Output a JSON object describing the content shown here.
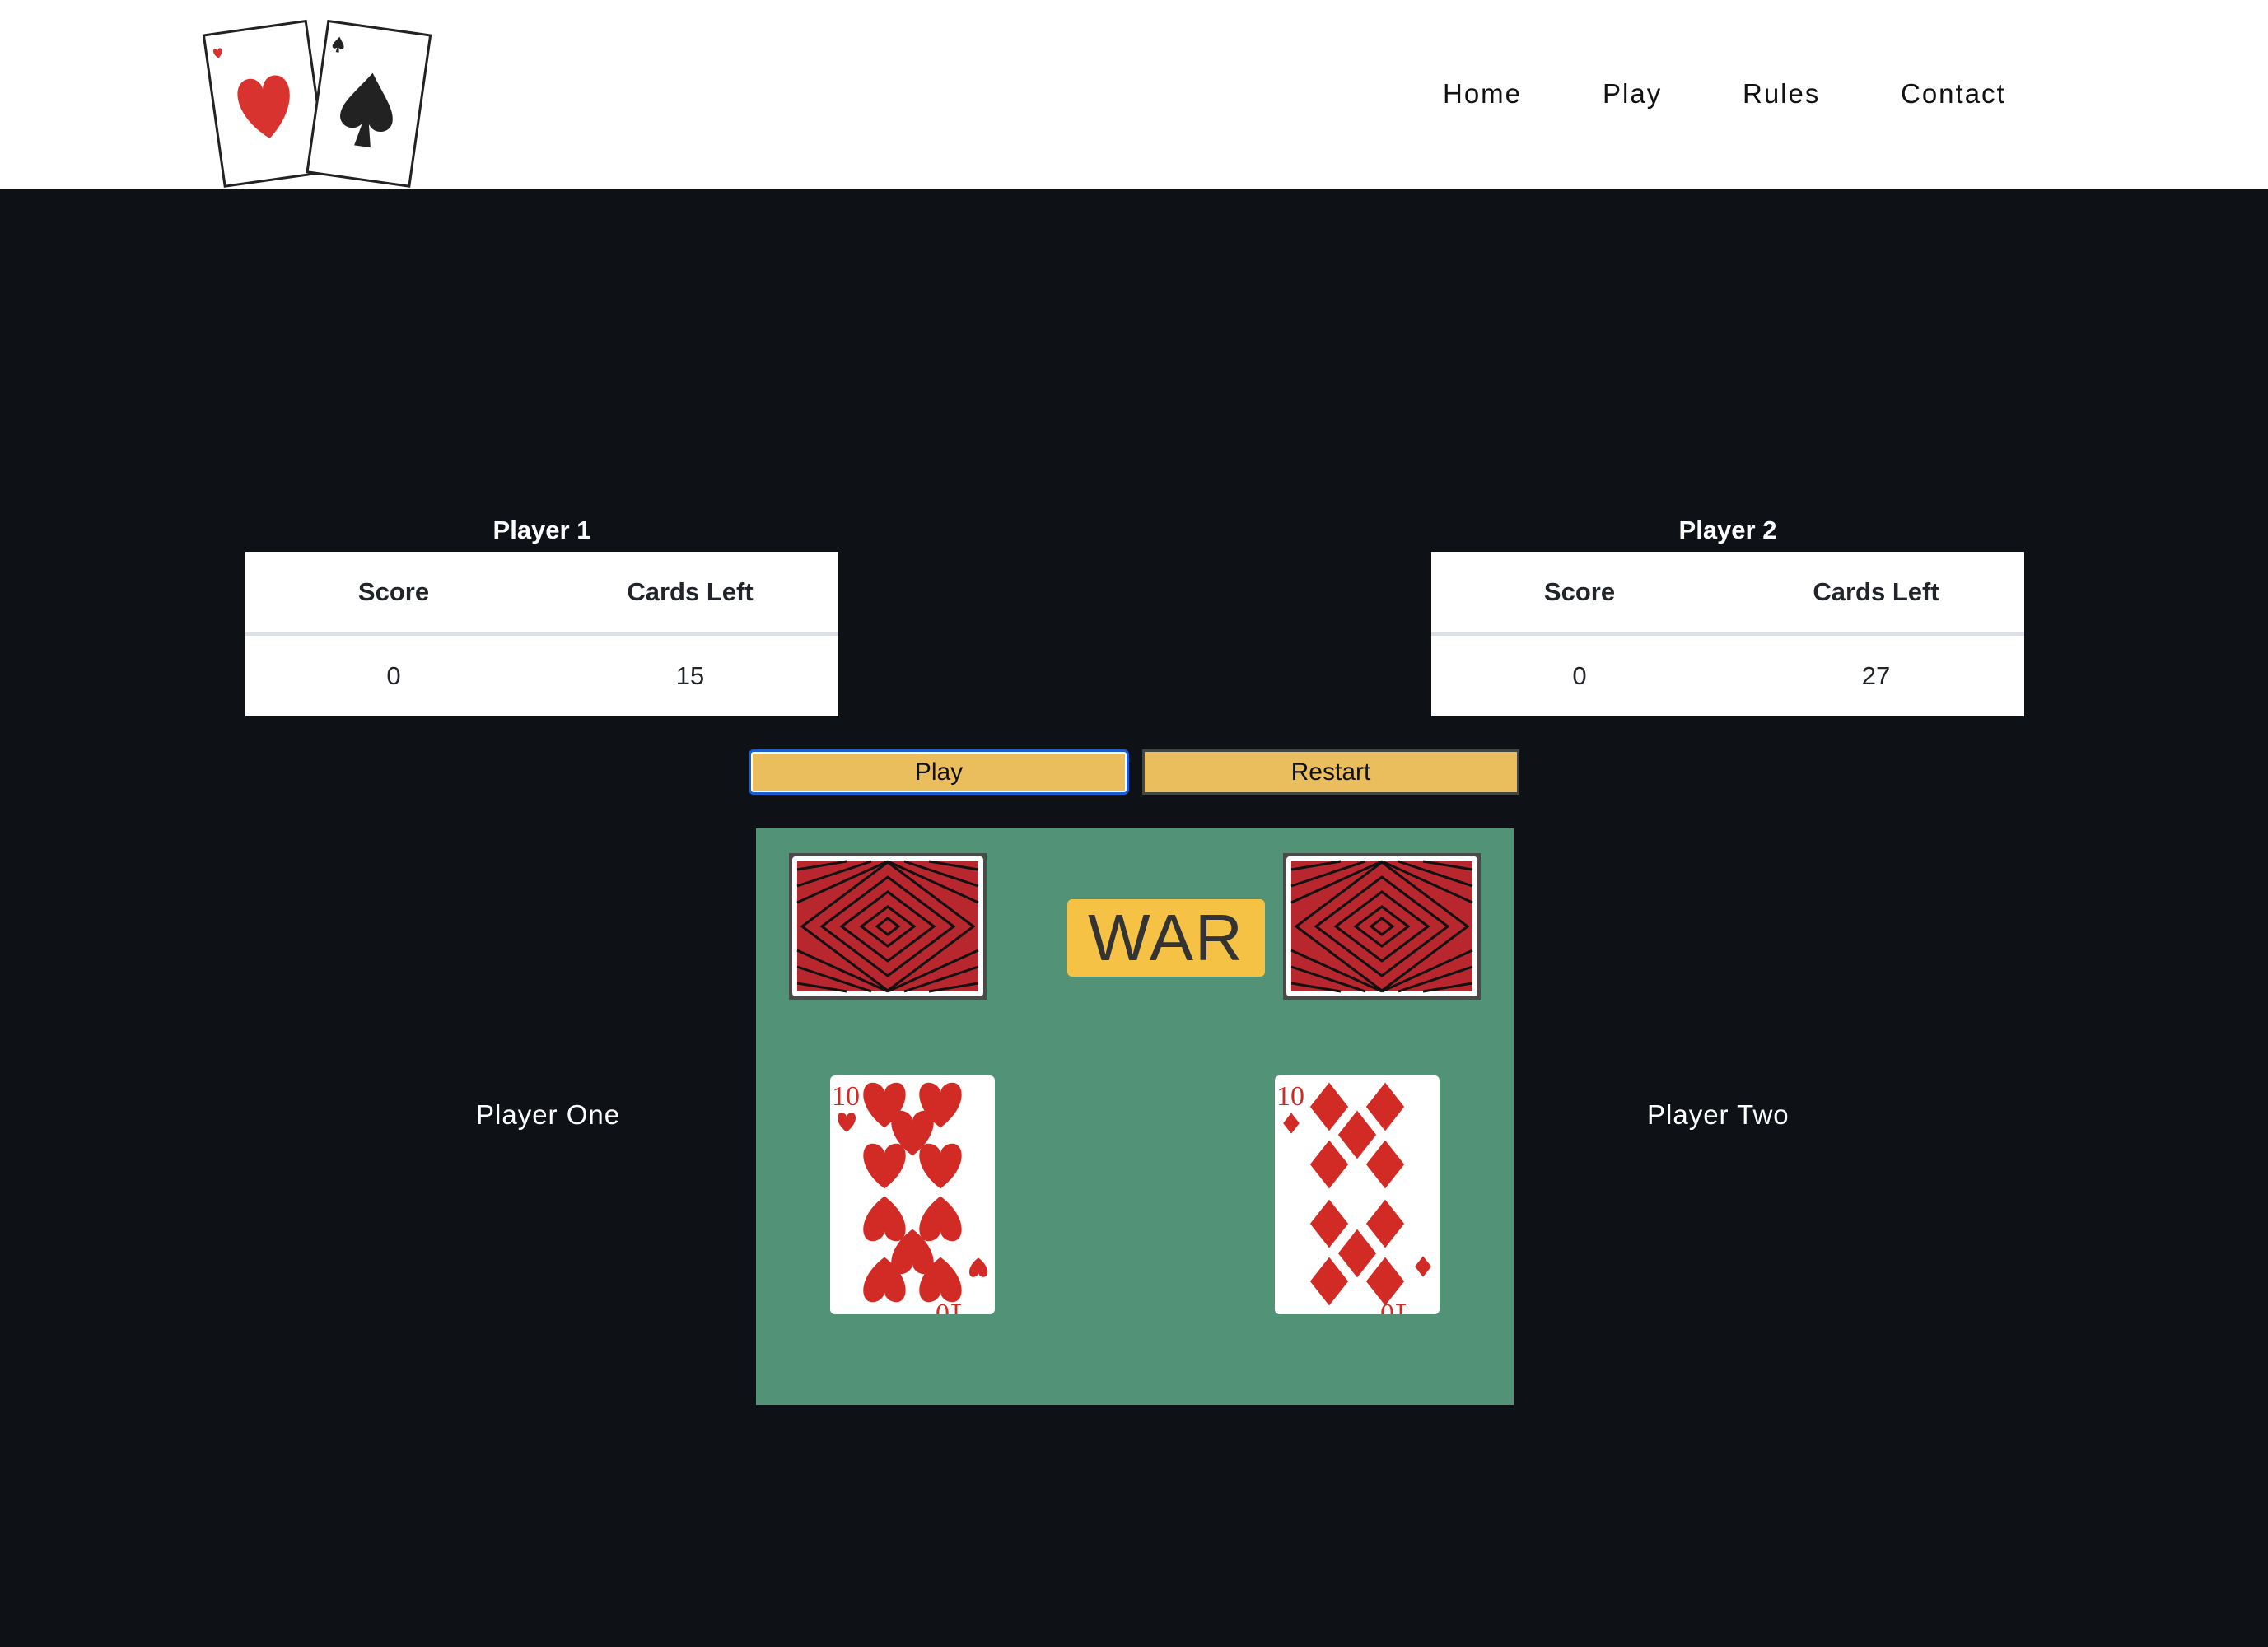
{
  "nav": {
    "items": [
      {
        "label": "Home"
      },
      {
        "label": "Play"
      },
      {
        "label": "Rules"
      },
      {
        "label": "Contact"
      }
    ]
  },
  "player1": {
    "caption": "Player 1",
    "headers": [
      "Score",
      "Cards Left"
    ],
    "score": "0",
    "cards_left": "15"
  },
  "player2": {
    "caption": "Player 2",
    "headers": [
      "Score",
      "Cards Left"
    ],
    "score": "0",
    "cards_left": "27"
  },
  "controls": {
    "play_label": "Play",
    "restart_label": "Restart"
  },
  "board": {
    "war_label": "WAR",
    "player_one_label": "Player One",
    "player_two_label": "Player Two",
    "player_one_card": {
      "rank": "10",
      "suit": "hearts"
    },
    "player_two_card": {
      "rank": "10",
      "suit": "diamonds"
    }
  },
  "colors": {
    "background": "#0e1116",
    "header": "#ffffff",
    "board": "#529277",
    "button": "#ebbe5d",
    "war_badge": "#f6c245",
    "card_back_red": "#b8262e",
    "suit_red": "#d22a24"
  }
}
